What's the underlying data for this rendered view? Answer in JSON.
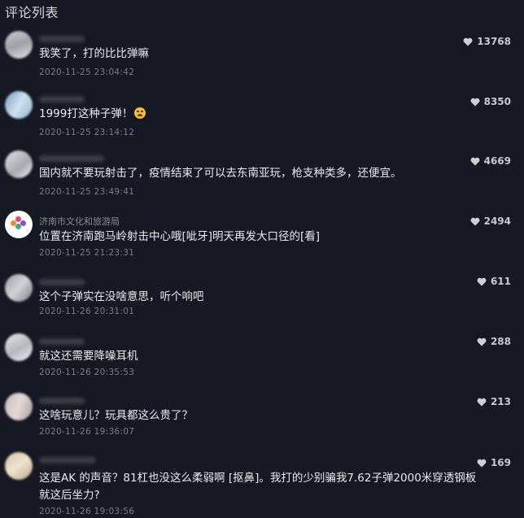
{
  "header": {
    "title": "评论列表"
  },
  "colors": {
    "background": "#161823",
    "text": "#ebebee",
    "muted": "#7c7d84",
    "heart": "#d0d0d4"
  },
  "comments": [
    {
      "username": "",
      "text": "我笑了，打的比比弹嘛",
      "time": "2020-11-25 23:04:42",
      "likes": "13768",
      "emoji": ""
    },
    {
      "username": "",
      "text": "1999打这种子弹！",
      "time": "2020-11-25 23:14:12",
      "likes": "8350",
      "emoji": "angry-emoji-icon"
    },
    {
      "username": "",
      "text": "国内就不要玩射击了，疫情结束了可以去东南亚玩，枪支种类多，还便宜。",
      "time": "2020-11-25 23:49:41",
      "likes": "4669",
      "emoji": ""
    },
    {
      "username": "济南市文化和旅游局",
      "text": "位置在济南跑马岭射击中心哦[呲牙]明天再发大口径的[看]",
      "time": "2020-11-25 21:23:31",
      "likes": "2494",
      "emoji": ""
    },
    {
      "username": "",
      "text": "这个子弹实在没啥意思，听个响吧",
      "time": "2020-11-26 20:31:01",
      "likes": "611",
      "emoji": ""
    },
    {
      "username": "",
      "text": "就这还需要降噪耳机",
      "time": "2020-11-26 20:35:53",
      "likes": "288",
      "emoji": ""
    },
    {
      "username": "",
      "text": "这啥玩意儿？玩具都这么贵了？",
      "time": "2020-11-26 19:36:07",
      "likes": "213",
      "emoji": ""
    },
    {
      "username": "",
      "text": "这是AK 的声音？81杠也没这么柔弱啊 [抠鼻]。我打的少别骗我7.62子弹2000米穿透钢板就这后坐力?",
      "time": "2020-11-26 19:03:56",
      "likes": "169",
      "emoji": ""
    }
  ]
}
